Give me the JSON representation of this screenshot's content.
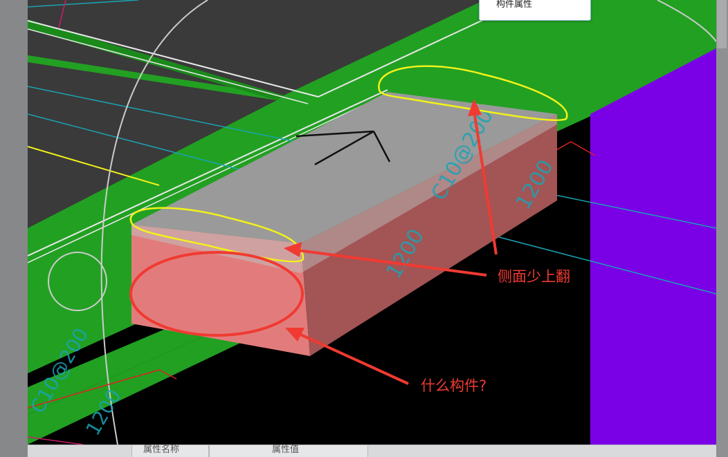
{
  "tooltip": {
    "text": "构件属性"
  },
  "viewport": {
    "rebar_label_main": "C10@200",
    "rebar_dim_1": "1200",
    "rebar_dim_2": "1200",
    "rebar_label_bottom": "C10@200",
    "rebar_dim_bottom": "1200"
  },
  "annotations": {
    "side_label": "侧面少上翻",
    "component_question": "什么构件?"
  },
  "property_panel": {
    "col_name": "属性名称",
    "col_value": "属性值"
  },
  "colors": {
    "ground_green": "#22a022",
    "dark_gray": "#3a3a3a",
    "slab_top": "#9a9a9a",
    "slab_front": "#e27c7c",
    "slab_side": "#a35454",
    "purple_wall": "#7a00e6",
    "annotation_red": "#f03a32",
    "highlight_yellow": "#f2f21a",
    "cyan_line": "#1aa3b5"
  }
}
